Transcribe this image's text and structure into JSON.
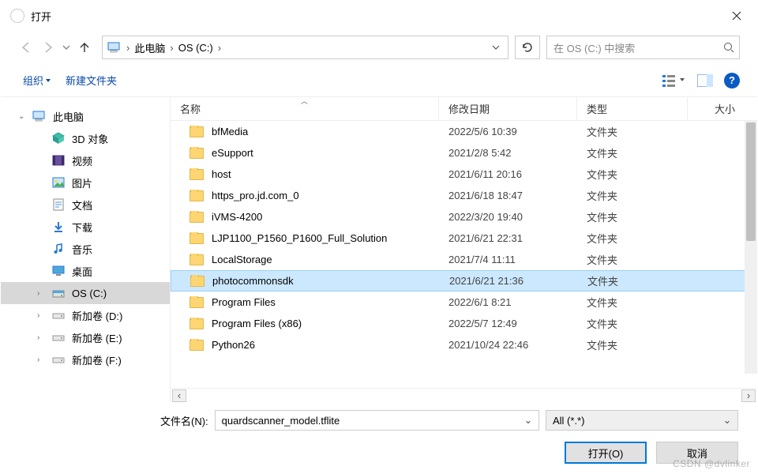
{
  "window": {
    "title": "打开"
  },
  "nav": {
    "back_enabled": false,
    "forward_enabled": false,
    "up_enabled": true
  },
  "breadcrumb": {
    "items": [
      "此电脑",
      "OS (C:)"
    ]
  },
  "search": {
    "placeholder": "在 OS (C:) 中搜索"
  },
  "toolbar": {
    "organize": "组织",
    "new_folder": "新建文件夹"
  },
  "tree": {
    "root": {
      "label": "此电脑"
    },
    "items": [
      {
        "label": "3D 对象",
        "icon": "cube"
      },
      {
        "label": "视频",
        "icon": "video"
      },
      {
        "label": "图片",
        "icon": "picture"
      },
      {
        "label": "文档",
        "icon": "doc"
      },
      {
        "label": "下载",
        "icon": "download"
      },
      {
        "label": "音乐",
        "icon": "music"
      },
      {
        "label": "桌面",
        "icon": "desktop"
      },
      {
        "label": "OS (C:)",
        "icon": "drive",
        "selected": true
      },
      {
        "label": "新加卷 (D:)",
        "icon": "drive2"
      },
      {
        "label": "新加卷 (E:)",
        "icon": "drive2"
      },
      {
        "label": "新加卷 (F:)",
        "icon": "drive2"
      }
    ]
  },
  "columns": {
    "name": "名称",
    "date": "修改日期",
    "type": "类型",
    "size": "大小",
    "sorted_by": "name",
    "sort_dir": "asc"
  },
  "folder_type_label": "文件夹",
  "rows": [
    {
      "name": "bfMedia",
      "date": "2022/5/6 10:39",
      "type": "文件夹",
      "selected": false
    },
    {
      "name": "eSupport",
      "date": "2021/2/8 5:42",
      "type": "文件夹",
      "selected": false
    },
    {
      "name": "host",
      "date": "2021/6/11 20:16",
      "type": "文件夹",
      "selected": false
    },
    {
      "name": "https_pro.jd.com_0",
      "date": "2021/6/18 18:47",
      "type": "文件夹",
      "selected": false
    },
    {
      "name": "iVMS-4200",
      "date": "2022/3/20 19:40",
      "type": "文件夹",
      "selected": false
    },
    {
      "name": "LJP1100_P1560_P1600_Full_Solution",
      "date": "2021/6/21 22:31",
      "type": "文件夹",
      "selected": false
    },
    {
      "name": "LocalStorage",
      "date": "2021/7/4 11:11",
      "type": "文件夹",
      "selected": false
    },
    {
      "name": "photocommonsdk",
      "date": "2021/6/21 21:36",
      "type": "文件夹",
      "selected": true
    },
    {
      "name": "Program Files",
      "date": "2022/6/1 8:21",
      "type": "文件夹",
      "selected": false
    },
    {
      "name": "Program Files (x86)",
      "date": "2022/5/7 12:49",
      "type": "文件夹",
      "selected": false
    },
    {
      "name": "Python26",
      "date": "2021/10/24 22:46",
      "type": "文件夹",
      "selected": false
    }
  ],
  "filename": {
    "label": "文件名(N):",
    "value": "quardscanner_model.tflite"
  },
  "filter": {
    "value": "All (*.*)"
  },
  "buttons": {
    "open": "打开(O)",
    "cancel": "取消"
  },
  "watermark": "CSDN @dvlinker"
}
